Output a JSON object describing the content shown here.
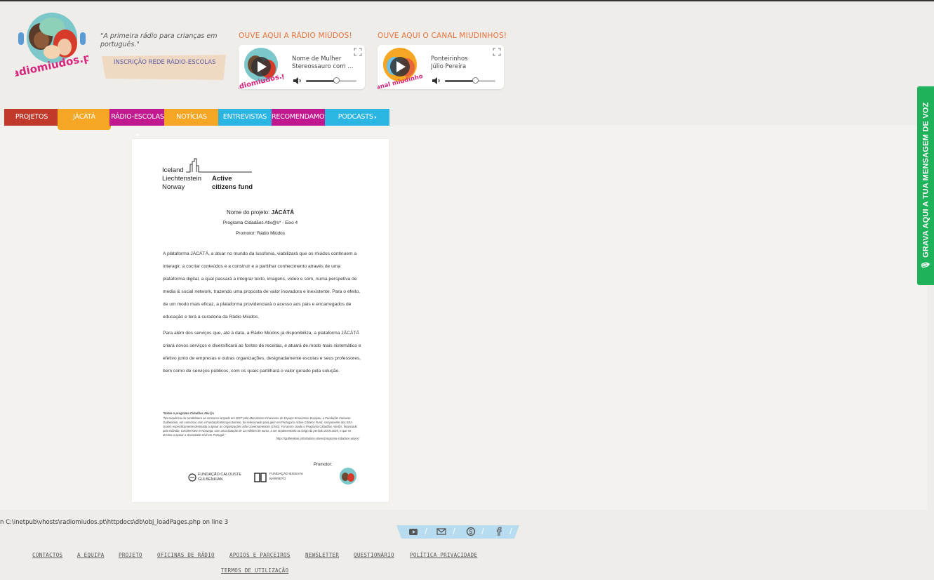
{
  "header": {
    "tagline": "\"A primeira rádio para crianças em português.\"",
    "signup_button": "INSCRIÇÃO REDE RÁDIO-ESCOLAS",
    "logo_text": "radiomiudos.pt"
  },
  "players": [
    {
      "title": "OUVE AQUI A RÁDIO MIÚDOS!",
      "line1": "Nome de Mulher",
      "line2": "Stereossauro com ...",
      "volume": 0.6,
      "thumb_text": "radiomiudos.pt"
    },
    {
      "title": "OUVE AQUI O CANAL MIUDINHOS!",
      "line1": "Ponteirinhos",
      "line2": "Júlio Pereira",
      "volume": 0.6,
      "thumb_text": "canal miudinhos"
    }
  ],
  "nav": {
    "tabs": [
      {
        "label": "PROJETOS",
        "color": "#c0392b"
      },
      {
        "label": "JÁCÁTÁ",
        "color": "#f5a623"
      },
      {
        "label": "RÁDIO-ESCOLAS",
        "color": "#c2188f"
      },
      {
        "label": "NOTÍCIAS",
        "color": "#f5a623"
      },
      {
        "label": "ENTREVISTAS",
        "color": "#2bb5e3"
      },
      {
        "label": "RECOMENDAMOS",
        "color": "#c2188f"
      },
      {
        "label": "PODCASTS",
        "color": "#2bb5e3"
      }
    ]
  },
  "document": {
    "eea": {
      "l1": "Iceland",
      "l2": "Liechtenstein",
      "l3": "Norway",
      "r1": "Active",
      "r2": "citizens fund"
    },
    "project_label": "Nome do projeto:",
    "project_name": "JÁCÁTÁ",
    "program": "Programa Cidadãos Ativ@s* - Eixo 4",
    "promoter_line": "Promotor: Rádio Miúdos",
    "paragraph1": "A plataforma JÁCÁTÁ, a atuar no mundo da lusofonia, viabilizará que os miúdos continuem a interagir, a cocriar conteúdos e a construir e a partilhar conhecimento através de uma plataforma digital, a qual passará a integrar texto, imagens, vídeo e som, numa perspetiva de media & social network, trazendo uma proposta de valor inovadora e inexistente. Para o efeito, de um modo mais eficaz, a plataforma providenciará o acesso aos pais e encarregados de educação e terá a curadoria da Rádio Miúdos.",
    "paragraph2": "Para além dos serviços que, até à data, a Rádio Miúdos já disponibiliza, a plataforma JÁCÁTÁ criará novos serviços e diversificará as fontes de receitas, e atuará de modo mais sistemático e efetivo junto de empresas e outras organizações, designadamente escolas e seus professores, bem como de serviços públicos, com os quais partilhará o valor gerado pela solução.",
    "footnote_title": "*Sobre o programa Cidadãos Ativ@s",
    "footnote": "\"Na sequência da candidatura ao concurso lançado em 2017 pelo Mecanismo Financeiro do Espaço Económico Europeu, a Fundação Calouste Gulbenkian, em consórcio com a Fundação Bissaya Barreto, foi selecionada para gerir em Portugal o Active Citizens Fund, componente dos EEA Grants especificamente destinada a apoiar as Organizações Não Governamentais (ONG). Foi assim criado o Programa Cidadãos Ativ@s, financiado pela Islândia, Liechtenstein e Noruega, com uma dotação de 11 milhões de euros, a ser implementado ao longo do período 2018-2024, e que se destina a apoiar a Sociedade Civil em Portugal.\"",
    "footnote_url": "https://gulbenkian.pt/cidadaos-ativos/programa-cidadaos-ativos/",
    "promotor_label": "Promotor:",
    "fund1": "FUNDAÇÃO CALOUSTE GULBENKIAN",
    "fund2": "FUNDAÇÃO BISSAYA BARRETO"
  },
  "voice_button": "GRAVA AQUI A TUA MENSAGEM DE VOZ",
  "error_text": "n C:\\inetpub\\vhosts\\radiomiudos.pt\\httpdocs\\db\\obj_loadPages.php on line 3",
  "social_icons": [
    "youtube-icon",
    "mail-icon",
    "skype-icon",
    "facebook-icon"
  ],
  "footer": {
    "links": [
      "CONTACTOS",
      "A EQUIPA",
      "PROJETO",
      "OFICINAS DE RÁDIO",
      "APOIOS E PARCEIROS",
      "NEWSLETTER",
      "QUESTIONÁRIO",
      "POLÍTICA PRIVACIDADE",
      "TERMOS DE UTILIZAÇÃO"
    ]
  }
}
